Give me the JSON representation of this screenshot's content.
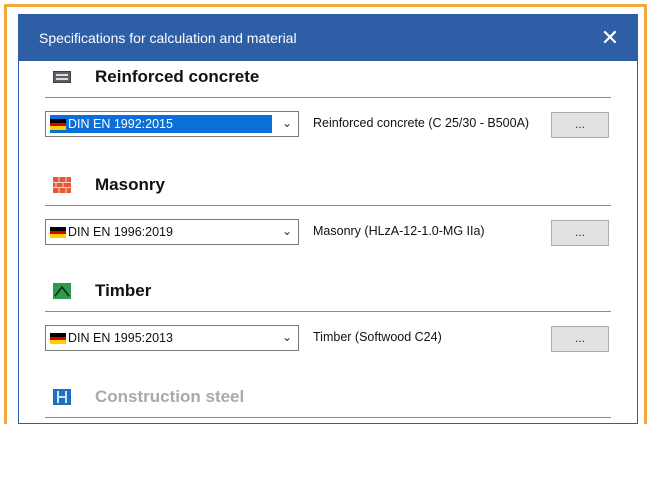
{
  "dialog": {
    "title": "Specifications for calculation and material",
    "close_glyph": "✕"
  },
  "sections": [
    {
      "icon": "reinforced-concrete-icon",
      "title": "Reinforced concrete",
      "standard": "DIN EN 1992:2015",
      "standard_selected": true,
      "material": "Reinforced concrete (C 25/30 - B500A)",
      "button": "...",
      "enabled": true
    },
    {
      "icon": "masonry-icon",
      "title": "Masonry",
      "standard": "DIN EN 1996:2019",
      "standard_selected": false,
      "material": "Masonry (HLzA-12-1.0-MG IIa)",
      "button": "...",
      "enabled": true
    },
    {
      "icon": "timber-icon",
      "title": "Timber",
      "standard": "DIN EN 1995:2013",
      "standard_selected": false,
      "material": "Timber (Softwood C24)",
      "button": "...",
      "enabled": true
    },
    {
      "icon": "construction-steel-icon",
      "title": "Construction steel",
      "enabled": false
    }
  ],
  "colors": {
    "titlebar": "#2e5ea6",
    "frame": "#f4a93c",
    "selection": "#0a6fd8"
  }
}
